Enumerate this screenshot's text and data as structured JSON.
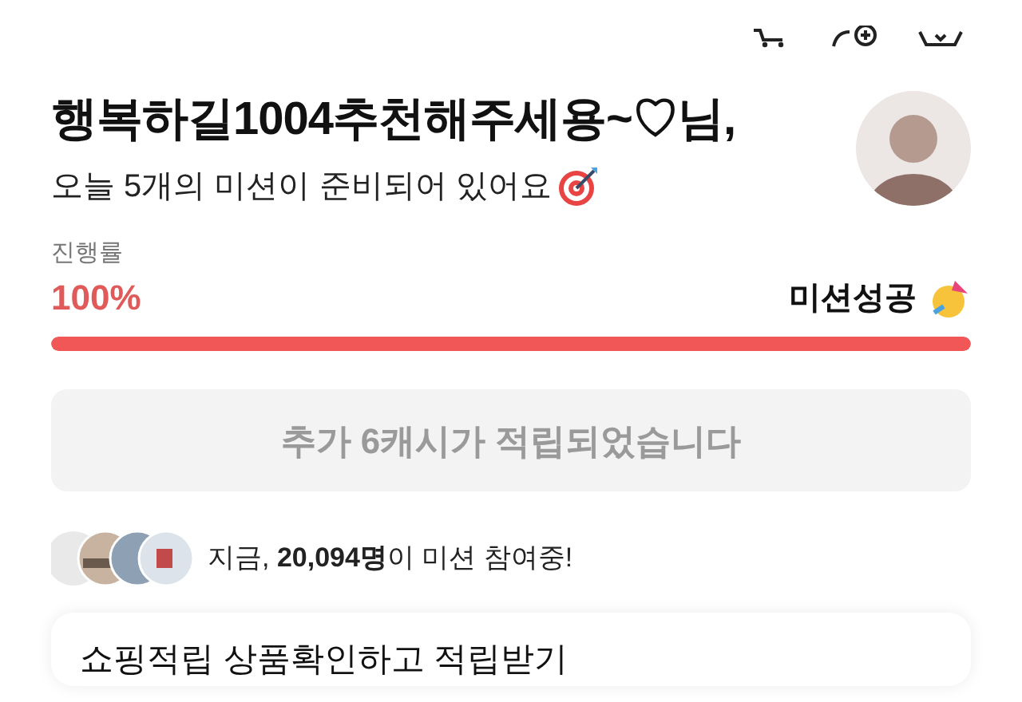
{
  "greeting": {
    "name": "행복하길1004추천해주세용~♡님,",
    "subtitle": "오늘 5개의 미션이 준비되어 있어요"
  },
  "progress": {
    "label": "진행률",
    "percent": "100%",
    "status": "미션성공",
    "level": 1
  },
  "reward_button": {
    "label": "추가 6캐시가 적립되었습니다",
    "disabled": true
  },
  "participants": {
    "text": "지금, **20,094명**이 미션 참여중!"
  },
  "missions": [
    {
      "title": "쇼핑적립 상품확인하고 적립받기"
    }
  ]
}
